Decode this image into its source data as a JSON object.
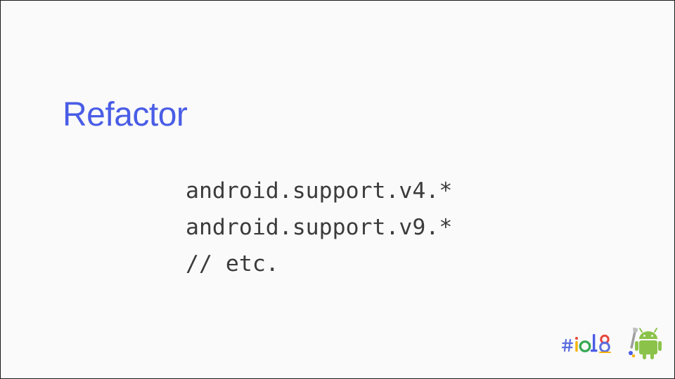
{
  "slide": {
    "title": "Refactor",
    "code_lines": [
      "android.support.v4.*",
      "android.support.v9.*",
      "// etc."
    ],
    "footer": {
      "event_logo_text": "#io18",
      "event_logo_icon": "io18-logo-icon",
      "mascot_icon": "android-mascot-icon"
    }
  },
  "colors": {
    "title": "#4a5de6",
    "code_text": "#3b3b3b",
    "background": "#fafafa"
  }
}
